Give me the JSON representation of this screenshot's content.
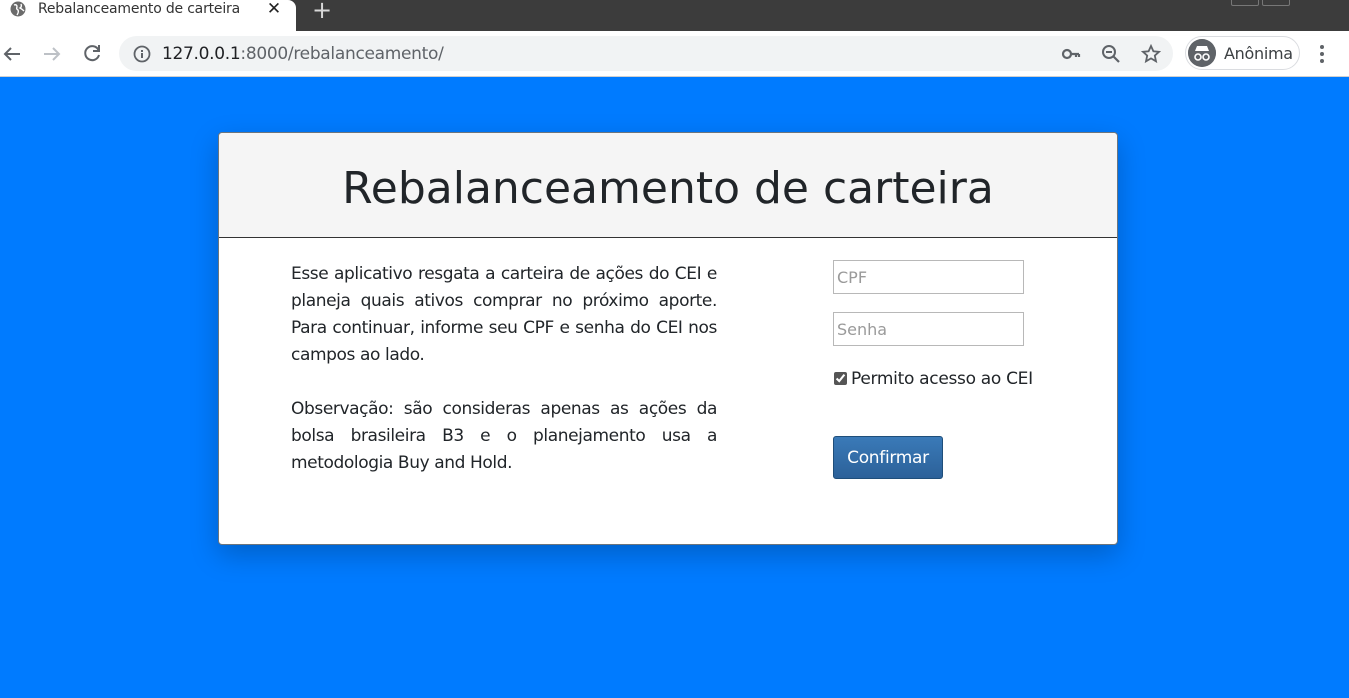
{
  "browser": {
    "tab_title": "Rebalanceamento de carteira",
    "tab_close": "✕",
    "new_tab": "+",
    "url_host": "127.0.0.1",
    "url_rest": ":8000/rebalanceamento/",
    "profile_label": "Anônima",
    "icons": [
      "globe-icon",
      "back-icon",
      "forward-icon",
      "reload-icon",
      "info-icon",
      "key-icon",
      "zoom-out-icon",
      "star-icon",
      "incognito-icon",
      "menu-icon"
    ]
  },
  "card": {
    "title": "Rebalanceamento de carteira",
    "paragraph1": "Esse aplicativo resgata a carteira de ações do CEI e planeja quais ativos comprar no próximo aporte. Para continuar, informe seu CPF e senha do CEI nos campos ao lado.",
    "paragraph2": "Observação: são consideras apenas as ações da bolsa brasileira B3 e o planejamento usa a metodologia Buy and Hold."
  },
  "form": {
    "cpf_placeholder": "CPF",
    "senha_placeholder": "Senha",
    "consent_label": "Permito acesso ao CEI",
    "consent_checked": true,
    "submit_label": "Confirmar"
  },
  "colors": {
    "page_background": "#007bff",
    "button_background": "#2c6199",
    "card_header": "#f5f5f5"
  }
}
